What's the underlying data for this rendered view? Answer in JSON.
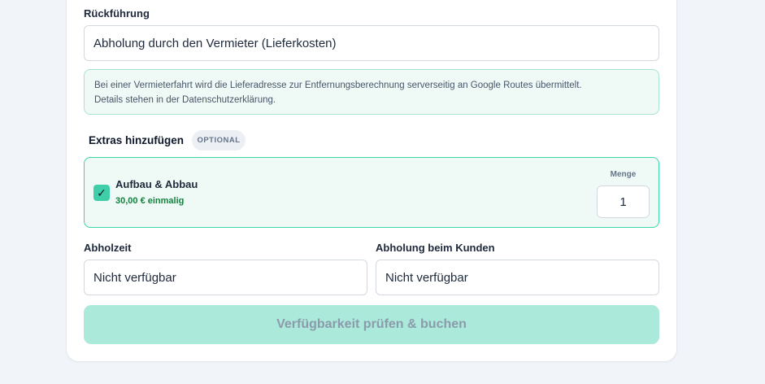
{
  "return": {
    "label": "Rückführung",
    "value": "Abholung durch den Vermieter (Lieferkosten)"
  },
  "info": {
    "line1": "Bei einer Vermieterfahrt wird die Lieferadresse zur Entfernungsberechnung serverseitig an Google Routes übermittelt.",
    "line2": "Details stehen in der Datenschutzerklärung."
  },
  "extras": {
    "title": "Extras hinzufügen",
    "badge": "OPTIONAL",
    "items": [
      {
        "name": "Aufbau & Abbau",
        "price": "30,00 € einmalig",
        "checked": true,
        "quantity_label": "Menge",
        "quantity": "1"
      }
    ]
  },
  "pickup_time": {
    "label": "Abholzeit",
    "value": "Nicht verfügbar"
  },
  "pickup_customer": {
    "label": "Abholung beim Kunden",
    "value": "Nicht verfügbar"
  },
  "submit": {
    "label": "Verfügbarkeit prüfen & buchen"
  },
  "colors": {
    "accent": "#3fcfa8",
    "accent_light": "#effaf7",
    "submit_disabled": "#abe9da",
    "price_green": "#15803d"
  },
  "icons": {
    "checkbox": "check-icon"
  }
}
